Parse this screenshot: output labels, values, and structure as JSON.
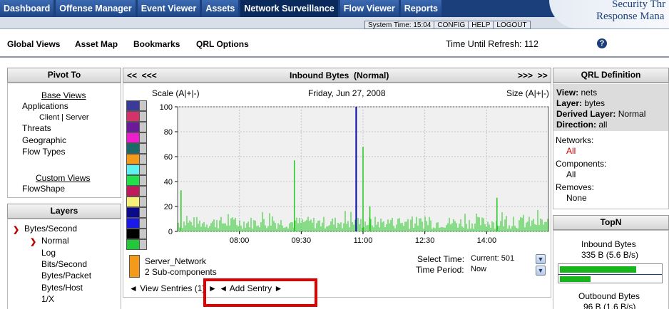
{
  "nav": {
    "tabs": [
      "Dashboard",
      "Offense Manager",
      "Event Viewer",
      "Assets",
      "Network Surveillance",
      "Flow Viewer",
      "Reports"
    ],
    "active_tab": "Network Surveillance",
    "brand_line1": "Security Thr",
    "brand_line2": "Response Mana"
  },
  "status": {
    "system_time": "System Time: 15:04",
    "config": "CONFIG",
    "help": "HELP",
    "logout": "LOGOUT"
  },
  "menu": {
    "global_views": "Global Views",
    "asset_map": "Asset Map",
    "bookmarks": "Bookmarks",
    "qrl_options": "QRL Options",
    "refresh": "Time Until Refresh: 112"
  },
  "pivot": {
    "title": "Pivot To",
    "base_views": "Base Views",
    "applications": "Applications",
    "client_server": "Client | Server",
    "threats": "Threats",
    "geographic": "Geographic",
    "flow_types": "Flow Types",
    "custom_views": "Custom Views",
    "flowshape": "FlowShape"
  },
  "layers": {
    "title": "Layers",
    "items": [
      "Bytes/Second",
      "Normal",
      "Log",
      "Bits/Second",
      "Bytes/Packet",
      "Bytes/Host",
      "1/X"
    ]
  },
  "graph": {
    "nav_left": "<<  <<<",
    "title": "Inbound Bytes  (Normal)",
    "nav_right": ">>>  >>",
    "scale": "Scale (A|+|-)",
    "date": "Friday, Jun 27, 2008",
    "size": "Size (A|+|-)",
    "legend_name": "Server_Network",
    "legend_sub": "2 Sub-components",
    "select_time_label": "Select Time:",
    "select_time_value": "Current: 501",
    "time_period_label": "Time Period:",
    "time_period_value": "Now",
    "view_sentries": "◄ View Sentries (1)",
    "add_sentry": "► ◄ Add Sentry ►",
    "swatch_colors": [
      "#3a3a9a",
      "#d3326b",
      "#6a1a9a",
      "#ee1ecf",
      "#1a6a6a",
      "#f39a1a",
      "#5ff0f0",
      "#22e04a",
      "#c01a5a",
      "#f6f07a",
      "#0a0a8a",
      "#1a1ae8",
      "#000000",
      "#22c83a"
    ],
    "legend_color": "#f39a1a"
  },
  "chart_data": {
    "type": "bar",
    "title": "Inbound Bytes  (Normal)",
    "subtitle": "Friday, Jun 27, 2008",
    "x_ticks": [
      "08:00",
      "09:30",
      "11:00",
      "12:30",
      "14:00"
    ],
    "y_ticks": [
      0,
      20,
      40,
      60,
      80,
      100
    ],
    "ylim": [
      0,
      100
    ],
    "grid": true,
    "series_color": "#22c81e",
    "marker_time": "10:50",
    "peaks": [
      {
        "time": "06:35",
        "value": 33
      },
      {
        "time": "09:20",
        "value": 57
      },
      {
        "time": "10:50",
        "value": 34
      },
      {
        "time": "11:00",
        "value": 68
      },
      {
        "time": "11:10",
        "value": 20
      },
      {
        "time": "14:15",
        "value": 27
      }
    ],
    "baseline_range": [
      2,
      12
    ]
  },
  "qrl": {
    "title": "QRL Definition",
    "view": "nets",
    "layer": "bytes",
    "derived_layer": "Normal",
    "direction": "all",
    "view_label": "View:",
    "layer_label": "Layer:",
    "derived_label": "Derived Layer:",
    "direction_label": "Direction:",
    "networks_label": "Networks:",
    "networks_value": "All",
    "components_label": "Components:",
    "components_value": "All",
    "removes_label": "Removes:",
    "removes_value": "None"
  },
  "topn": {
    "title": "TopN",
    "inbound_label": "Inbound Bytes",
    "inbound_value": "335 B (5.6 B/s)",
    "inbound_bar1": 0.75,
    "inbound_bar2": 0.3,
    "outbound_label": "Outbound Bytes",
    "outbound_value": "96 B (1.6 B/s)"
  }
}
